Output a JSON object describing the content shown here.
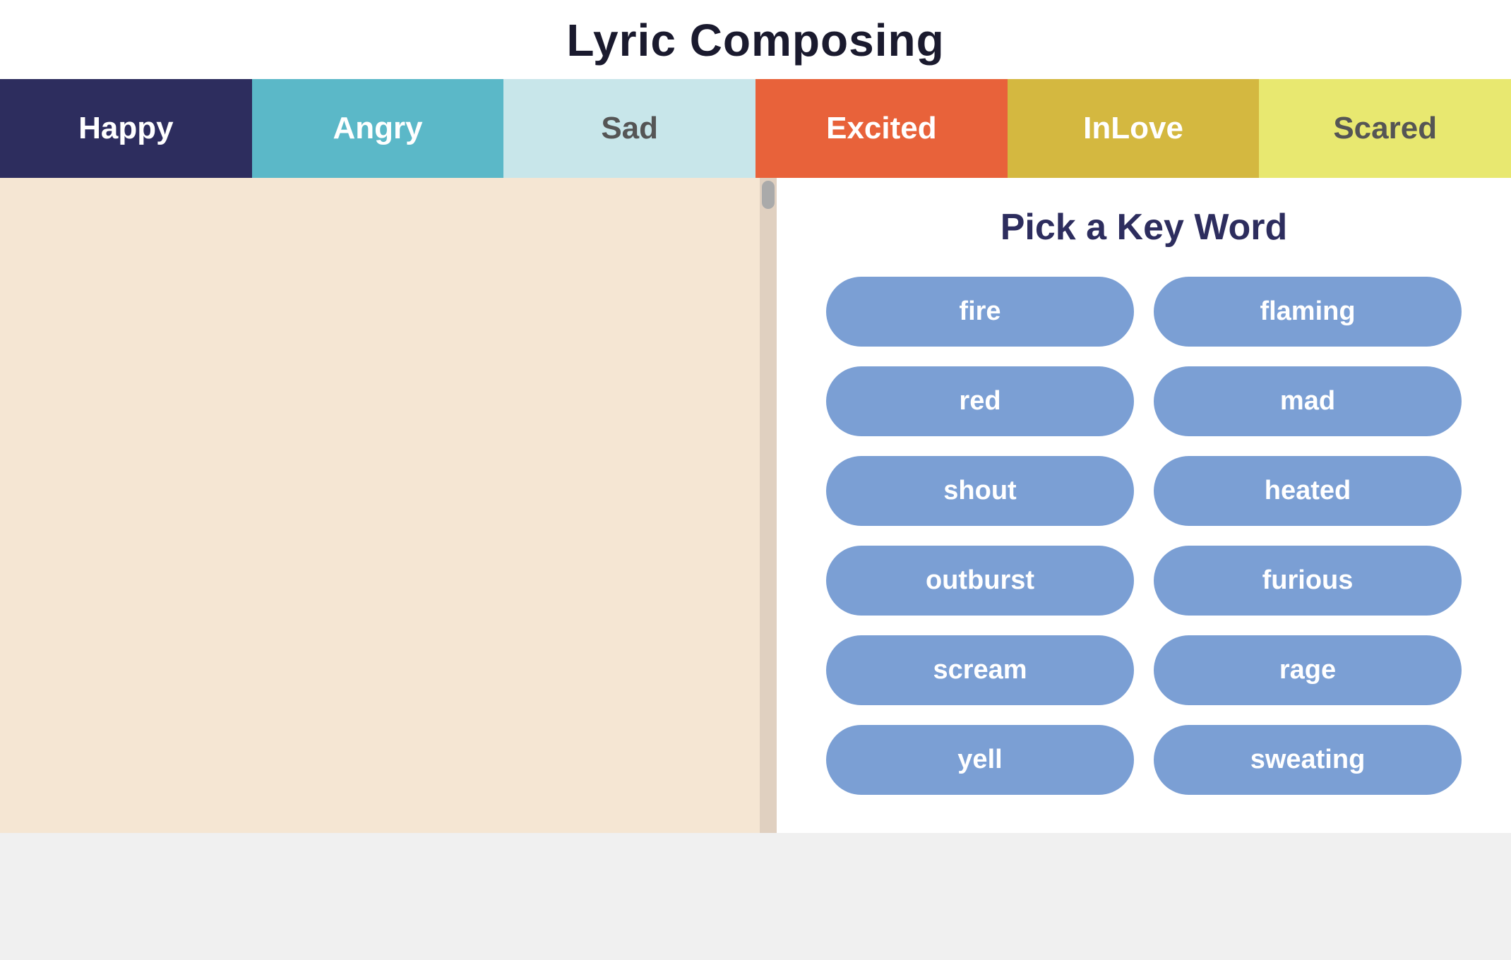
{
  "page": {
    "title": "Lyric Composing"
  },
  "tabs": [
    {
      "id": "happy",
      "label": "Happy",
      "color": "#2d2d5e",
      "textColor": "#ffffff"
    },
    {
      "id": "angry",
      "label": "Angry",
      "color": "#5bb8c8",
      "textColor": "#ffffff"
    },
    {
      "id": "sad",
      "label": "Sad",
      "color": "#c8e6ea",
      "textColor": "#555555"
    },
    {
      "id": "excited",
      "label": "Excited",
      "color": "#e8623a",
      "textColor": "#ffffff"
    },
    {
      "id": "inlove",
      "label": "InLove",
      "color": "#d4b840",
      "textColor": "#ffffff"
    },
    {
      "id": "scared",
      "label": "Scared",
      "color": "#e8e870",
      "textColor": "#555555"
    }
  ],
  "keyword_panel": {
    "title": "Pick a Key Word",
    "keywords": [
      {
        "id": "fire",
        "label": "fire"
      },
      {
        "id": "flaming",
        "label": "flaming"
      },
      {
        "id": "red",
        "label": "red"
      },
      {
        "id": "mad",
        "label": "mad"
      },
      {
        "id": "shout",
        "label": "shout"
      },
      {
        "id": "heated",
        "label": "heated"
      },
      {
        "id": "outburst",
        "label": "outburst"
      },
      {
        "id": "furious",
        "label": "furious"
      },
      {
        "id": "scream",
        "label": "scream"
      },
      {
        "id": "rage",
        "label": "rage"
      },
      {
        "id": "yell",
        "label": "yell"
      },
      {
        "id": "sweating",
        "label": "sweating"
      }
    ]
  }
}
